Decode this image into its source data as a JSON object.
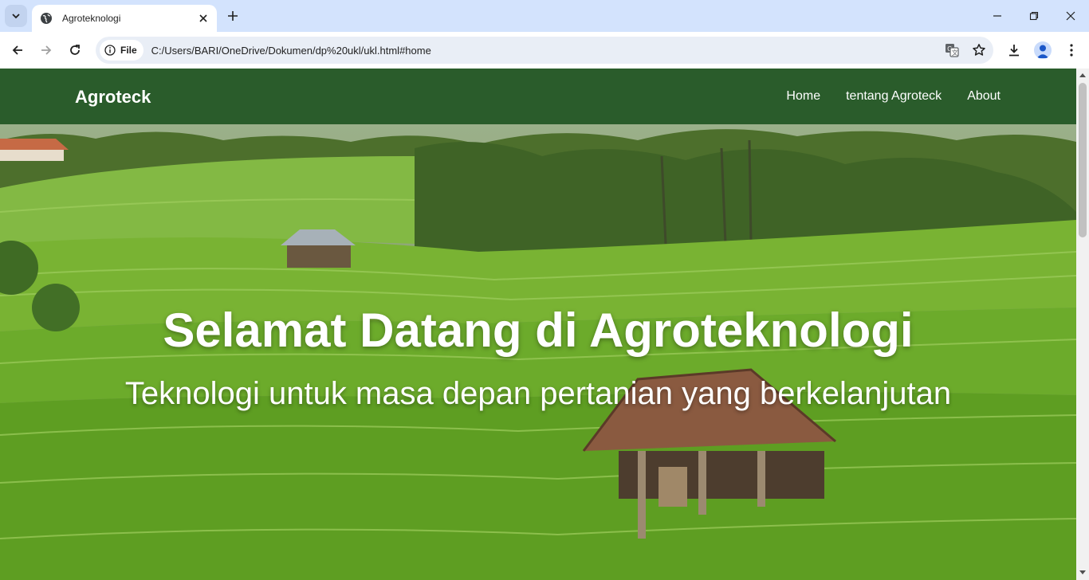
{
  "browser": {
    "tab": {
      "title": "Agroteknologi",
      "favicon": "globe-icon"
    },
    "address_bar": {
      "chip_label": "File",
      "url": "C:/Users/BARI/OneDrive/Dokumen/dp%20ukl/ukl.html#home"
    },
    "icons": [
      "tab-search-icon",
      "globe-icon",
      "close-icon",
      "new-tab-icon",
      "minimize-icon",
      "restore-icon",
      "window-close-icon",
      "back-icon",
      "forward-icon",
      "reload-icon",
      "info-icon",
      "translate-icon",
      "bookmark-star-icon",
      "download-icon",
      "profile-icon",
      "menu-dots-icon"
    ]
  },
  "site": {
    "brand": "Agroteck",
    "nav": [
      {
        "label": "Home"
      },
      {
        "label": "tentang Agroteck"
      },
      {
        "label": "About"
      }
    ],
    "hero": {
      "title": "Selamat Datang di Agroteknologi",
      "subtitle": "Teknologi untuk masa depan pertanian yang berkelanjutan"
    },
    "colors": {
      "navbar": "#2a5c2b",
      "text": "#ffffff"
    }
  }
}
